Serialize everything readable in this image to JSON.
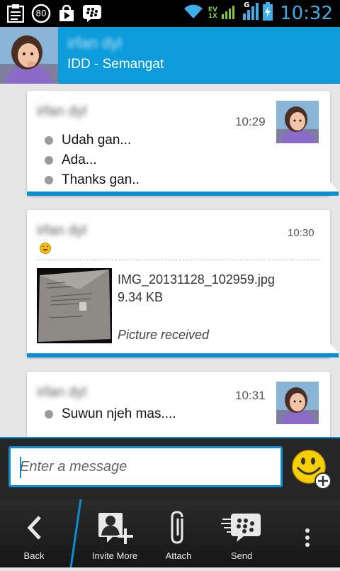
{
  "status_bar": {
    "time": "10:32",
    "notification_count": "80",
    "network_label_top": "EV",
    "network_label_bottom": "1X",
    "data_type": "G",
    "icons": [
      "clipboard-icon",
      "notification-count-icon",
      "play-store-icon",
      "blackberry-icon",
      "wifi-icon",
      "signal-icon",
      "battery-charging-icon"
    ]
  },
  "header": {
    "contact_name": "irfan dyl",
    "status_message": "IDD - Semangat"
  },
  "messages": [
    {
      "sender": "irfan dyl",
      "time": "10:29",
      "items": [
        "Udah gan...",
        "Ada...",
        "Thanks gan.."
      ]
    },
    {
      "sender": "irfan dyl",
      "time": "10:30",
      "emoticon": "laughing-emoticon-icon",
      "attachment": {
        "file_name": "IMG_20131128_102959.jpg",
        "file_size": "9.34 KB",
        "status": "Picture received"
      }
    },
    {
      "sender": "irfan dyl",
      "time": "10:31",
      "items": [
        "Suwun njeh mas...."
      ]
    }
  ],
  "composer": {
    "placeholder": "Enter a message"
  },
  "action_bar": {
    "back_label": "Back",
    "invite_label": "Invite More",
    "attach_label": "Attach",
    "send_label": "Send"
  },
  "colors": {
    "accent": "#0c8fd0",
    "header": "#0c9bdb",
    "time_text": "#3cb0e6"
  }
}
